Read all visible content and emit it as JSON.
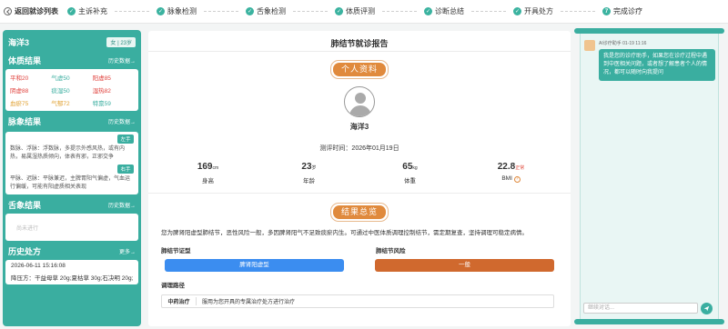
{
  "topbar": {
    "back_label": "返回就诊列表",
    "steps": [
      "主诉补充",
      "脉象检测",
      "舌象检测",
      "体质评测",
      "诊断总结",
      "开具处方"
    ],
    "final_step_number": "7",
    "final_step_label": "完成诊疗"
  },
  "patient": {
    "name": "海洋3",
    "tag": "女 | 23岁"
  },
  "constitution": {
    "title": "体质结果",
    "more": "历史数据→",
    "items": [
      {
        "label": "平和20",
        "color": "#e0413c"
      },
      {
        "label": "气虚50",
        "color": "#3aaea0"
      },
      {
        "label": "阳虚85",
        "color": "#e0413c"
      },
      {
        "label": "阴虚88",
        "color": "#e0413c"
      },
      {
        "label": "痰湿50",
        "color": "#3aaea0"
      },
      {
        "label": "湿热82",
        "color": "#e0413c"
      },
      {
        "label": "血瘀75",
        "color": "#e0a030"
      },
      {
        "label": "气郁72",
        "color": "#e0a030"
      },
      {
        "label": "特禀59",
        "color": "#3aaea0"
      }
    ]
  },
  "pulse": {
    "title": "脉象结果",
    "more": "历史数据→",
    "left_label": "左手",
    "left_text": "数脉、浮脉：浮数脉，多提示外感风热，或有内热，易属湿热质倾向，体表有邪，正邪交争",
    "right_label": "右手",
    "right_text": "平脉、迟脉：平脉兼迟，主脾胃阳气偏虚，气血运行偏缓，可能有阳虚质相关表现"
  },
  "tongue": {
    "title": "舌象结果",
    "more": "历史数据→",
    "empty": "尚未进行"
  },
  "history": {
    "title": "历史处方",
    "more": "更多→",
    "date": "2026-06-11 15:16:08",
    "rx": "降压方：干益母草 20g;夏枯草 30g;石决明 20g;"
  },
  "report": {
    "title": "肺结节就诊报告",
    "profile_ribbon": "个人资料",
    "patient_name": "海洋3",
    "eval_time": "测评时间：2026年01月19日",
    "stats": [
      {
        "value": "169",
        "unit": "cm",
        "label": "身高"
      },
      {
        "value": "23",
        "unit": "岁",
        "label": "年龄"
      },
      {
        "value": "65",
        "unit": "kg",
        "label": "体重"
      },
      {
        "value": "22.8",
        "unit": "正常",
        "label": "BMI"
      }
    ],
    "summary_ribbon": "结果总览",
    "summary": "您为脾肾阳虚型肺结节，恶性风险一般，多因脾肾阳气不足致痰瘀内生。可通过中医体质调理控制结节，需定期复查，坚持调理可稳定病情。",
    "type_label": "肺结节证型",
    "risk_label": "肺结节风险",
    "type_value": "脾肾阳虚型",
    "risk_value": "一般",
    "type_color": "#3b8df0",
    "risk_color": "#d0692e",
    "path_label": "调理路径",
    "path_key": "中药治疗",
    "path_value": "服用为您开具的专属治疗处方进行治疗"
  },
  "chat": {
    "sender": "AI诊疗助手 01-19 11:16",
    "message": "我是您的诊疗助手，如果您在诊疗过程中遇到中医相关问题，或者想了解患者个人的情况，都可以随时向我提问",
    "input_placeholder": "继续对话..."
  }
}
